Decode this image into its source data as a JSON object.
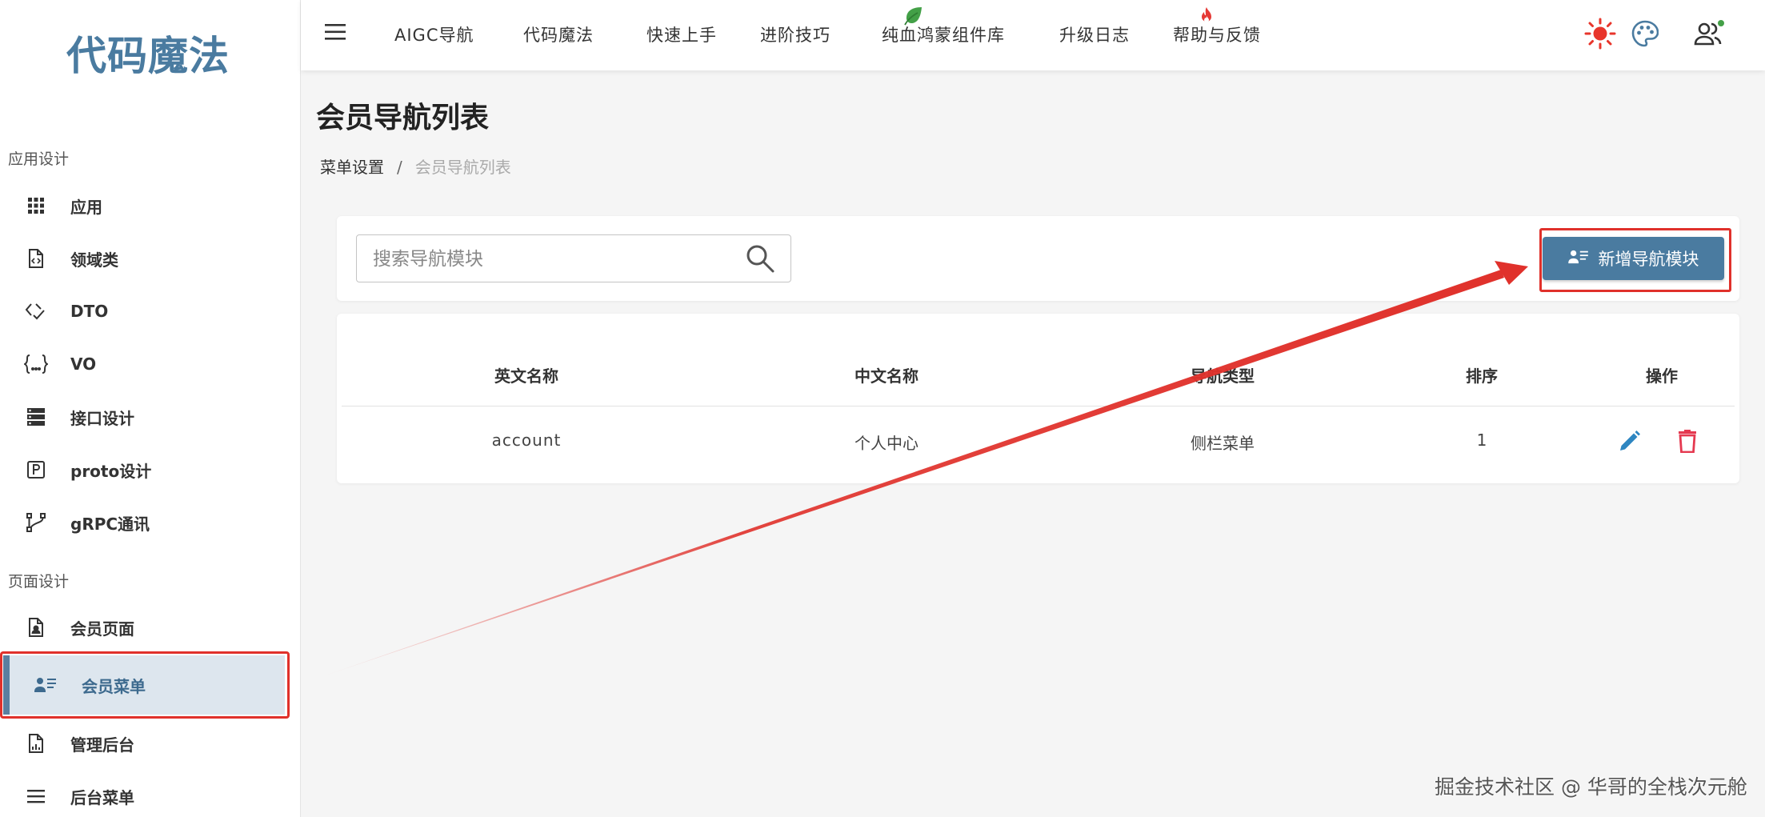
{
  "sidebar": {
    "logo": "代码魔法",
    "sections": [
      {
        "title": "应用设计"
      },
      {
        "title": "页面设计"
      }
    ],
    "items": [
      {
        "label": "应用",
        "icon": "grid-icon"
      },
      {
        "label": "领域类",
        "icon": "code-file-icon"
      },
      {
        "label": "DTO",
        "icon": "code-check-icon"
      },
      {
        "label": "VO",
        "icon": "braces-icon"
      },
      {
        "label": "接口设计",
        "icon": "server-icon"
      },
      {
        "label": "proto设计",
        "icon": "p-box-icon"
      },
      {
        "label": "gRPC通讯",
        "icon": "fork-icon"
      },
      {
        "label": "会员页面",
        "icon": "account-file-icon"
      },
      {
        "label": "会员菜单",
        "icon": "account-details-icon"
      },
      {
        "label": "管理后台",
        "icon": "chart-file-icon"
      },
      {
        "label": "后台菜单",
        "icon": "menu-icon"
      }
    ]
  },
  "topbar": {
    "nav": [
      "AIGC导航",
      "代码魔法",
      "快速上手",
      "进阶技巧",
      "纯血鸿蒙组件库",
      "升级日志",
      "帮助与反馈"
    ]
  },
  "main": {
    "title": "会员导航列表",
    "breadcrumb": {
      "parent": "菜单设置",
      "separator": "/",
      "current": "会员导航列表"
    },
    "search": {
      "placeholder": "搜索导航模块",
      "value": ""
    },
    "add_button": "新增导航模块",
    "table": {
      "columns": [
        "英文名称",
        "中文名称",
        "导航类型",
        "排序",
        "操作"
      ],
      "rows": [
        {
          "en": "account",
          "zh": "个人中心",
          "type": "侧栏菜单",
          "order": "1"
        }
      ]
    }
  },
  "watermark": "掘金技术社区 @ 华哥的全栈次元舱",
  "colors": {
    "brand": "#4a7ba0",
    "active_bg": "#dde6ee",
    "annotation_red": "#e0312b",
    "edit_blue": "#2e86c1",
    "delete_red": "#e53950",
    "sun": "#e8352b"
  }
}
